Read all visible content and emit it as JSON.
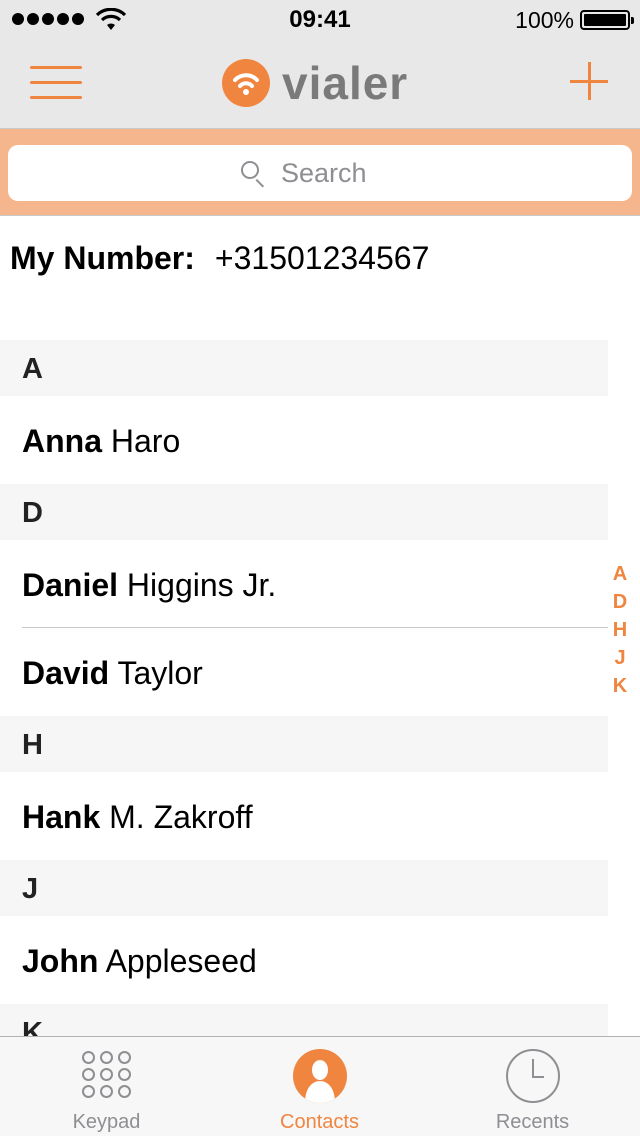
{
  "status": {
    "time": "09:41",
    "battery_pct": "100%",
    "signal_bars": 5
  },
  "navbar": {
    "logo_text": "vialer",
    "menu_icon": "hamburger-icon",
    "add_icon": "plus-icon"
  },
  "search": {
    "placeholder": "Search"
  },
  "my_number": {
    "label": "My Number:",
    "value": "+31501234567"
  },
  "sections": [
    {
      "letter": "A",
      "contacts": [
        {
          "first": "Anna",
          "last": "Haro"
        }
      ]
    },
    {
      "letter": "D",
      "contacts": [
        {
          "first": "Daniel",
          "last": "Higgins Jr."
        },
        {
          "first": "David",
          "last": "Taylor"
        }
      ]
    },
    {
      "letter": "H",
      "contacts": [
        {
          "first": "Hank",
          "last": "M. Zakroff"
        }
      ]
    },
    {
      "letter": "J",
      "contacts": [
        {
          "first": "John",
          "last": "Appleseed"
        }
      ]
    },
    {
      "letter": "K",
      "contacts": []
    }
  ],
  "index_letters": [
    "A",
    "D",
    "H",
    "J",
    "K"
  ],
  "tabs": [
    {
      "label": "Keypad",
      "icon": "keypad-icon",
      "active": false
    },
    {
      "label": "Contacts",
      "icon": "contacts-icon",
      "active": true
    },
    {
      "label": "Recents",
      "icon": "clock-icon",
      "active": false
    }
  ],
  "colors": {
    "accent": "#f0853f",
    "search_bar_bg": "#f5b58d",
    "nav_bg": "#e8e8e8",
    "logo_text": "#7a7a7a"
  }
}
